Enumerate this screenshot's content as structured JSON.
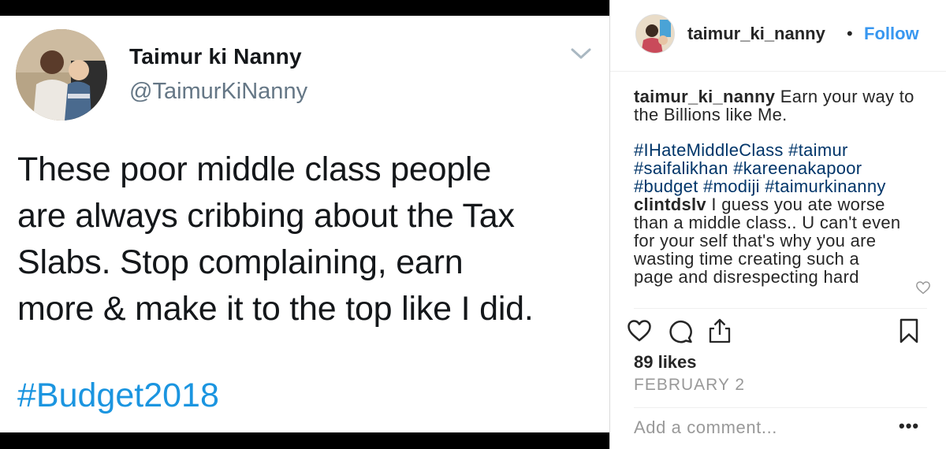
{
  "tweet": {
    "display_name": "Taimur ki Nanny",
    "handle": "@TaimurKiNanny",
    "body": "These poor middle class people\nare always cribbing about the Tax\nSlabs.  Stop complaining, earn\nmore & make it to the top like I did.",
    "hashtag": "#Budget2018",
    "colors": {
      "text": "#14171a",
      "secondary": "#657786",
      "link": "#1b95e0"
    },
    "icons": {
      "menu": "chevron-down-icon",
      "avatar": "avatar-photo"
    }
  },
  "instagram": {
    "header": {
      "username": "taimur_ki_nanny",
      "separator": "•",
      "follow_label": "Follow"
    },
    "caption": {
      "username": "taimur_ki_nanny",
      "text": "Earn your way to the Billions like Me.",
      "hashtags": [
        "#IHateMiddleClass",
        "#taimur",
        "#saifalikhan",
        "#kareenakapoor",
        "#budget",
        "#modiji",
        "#taimurkinanny"
      ]
    },
    "comment": {
      "username": "clintdslv",
      "text": "I guess you ate worse than a middle class.. U can't even for your self that's why you are wasting time creating such a page and disrespecting hard"
    },
    "likes": "89 likes",
    "date": "FEBRUARY 2",
    "add_comment_placeholder": "Add a comment...",
    "more_label": "•••",
    "icons": [
      "heart-icon",
      "comment-icon",
      "share-icon",
      "bookmark-icon"
    ],
    "colors": {
      "text": "#262626",
      "link": "#3897f0",
      "hashtag": "#003569",
      "muted": "#999999"
    }
  }
}
